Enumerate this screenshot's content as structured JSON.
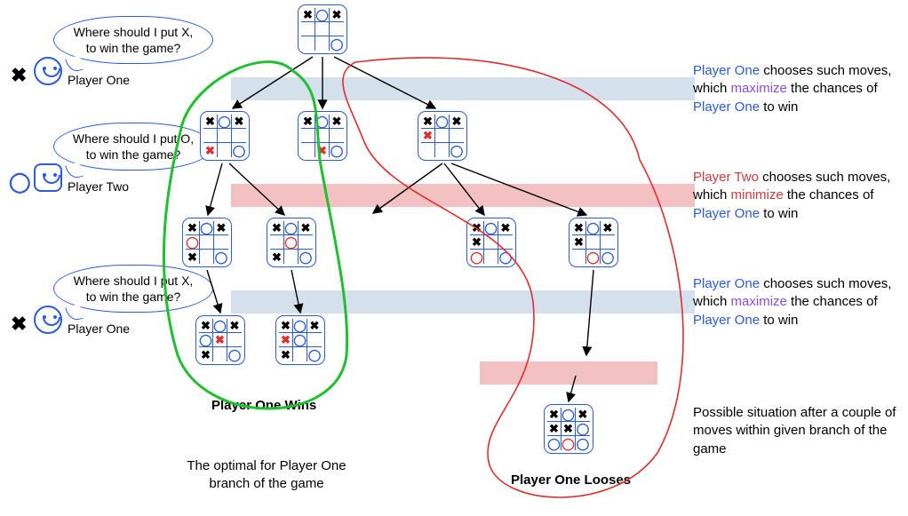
{
  "diagram_type": "minimax-game-tree",
  "game": "tic-tac-toe",
  "players": {
    "one": {
      "name": "Player One",
      "symbol": "X",
      "bubble": "Where should I put X,\nto win the game?"
    },
    "two": {
      "name": "Player Two",
      "symbol": "O",
      "bubble": "Where should I put O,\nto win the game?"
    }
  },
  "captions": {
    "level1": {
      "pre": "Player One",
      "mid1": " chooses such moves,\nwhich ",
      "kw": "maximize",
      "mid2": " the chances\nof ",
      "suf": "Player One",
      "end": " to win"
    },
    "level2": {
      "pre": "Player Two",
      "mid1": " chooses such moves,\nwhich ",
      "kw": "minimize",
      "mid2": " the chances\nof ",
      "suf": "Player One",
      "end": " to win"
    },
    "level3": {
      "pre": "Player One",
      "mid1": " chooses such moves,\nwhich ",
      "kw": "maximize",
      "mid2": " the chances\nof ",
      "suf": "Player One",
      "end": " to win"
    },
    "loose_note": "Possible situation after a couple\nof moves within given branch of\nthe game"
  },
  "labels": {
    "wins": "Player One Wins",
    "looses": "Player One Looses",
    "optimal": "The optimal for Player One\nbranch of the game"
  },
  "regions": {
    "green": "optimal-branch-player-one-wins",
    "red": "suboptimal-branch-player-one-looses"
  },
  "boards": {
    "root": [
      "x",
      "o",
      "x",
      "",
      "",
      "",
      "",
      "",
      "o"
    ],
    "l1a": [
      "x",
      "o",
      "x",
      "",
      "",
      "",
      "rx",
      "",
      "o"
    ],
    "l1b": [
      "x",
      "o",
      "x",
      "",
      "",
      "",
      "",
      "rx",
      "o"
    ],
    "l1c": [
      "x",
      "o",
      "x",
      "rx",
      "",
      "",
      "",
      "",
      "o"
    ],
    "l2a": [
      "x",
      "o",
      "x",
      "ro",
      "",
      "",
      "x",
      "",
      "o"
    ],
    "l2b": [
      "x",
      "o",
      "x",
      "",
      "ro",
      "",
      "x",
      "",
      "o"
    ],
    "l2c": [
      "x",
      "o",
      "x",
      "x",
      "",
      "",
      "ro",
      "",
      "o"
    ],
    "l2d": [
      "x",
      "o",
      "x",
      "x",
      "",
      "",
      "",
      "ro",
      "o"
    ],
    "l3a": [
      "x",
      "o",
      "x",
      "o",
      "rx",
      "",
      "x",
      "",
      "o"
    ],
    "l3b": [
      "x",
      "o",
      "x",
      "rx",
      "o",
      "",
      "x",
      "",
      "o"
    ],
    "final": [
      "x",
      "o",
      "x",
      "x",
      "x",
      "o",
      "o",
      "ro",
      "o"
    ]
  },
  "colors": {
    "blue_band": "#d4e1ed",
    "pink_band": "#f3c1c1",
    "p1": "#2b5bd8",
    "p2": "#d23a3a",
    "max": "#8a4de0",
    "green": "#1fbf2f",
    "red": "#e02d2d"
  }
}
